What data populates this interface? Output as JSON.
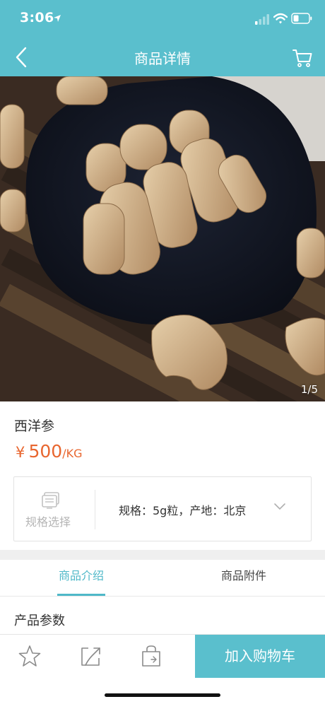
{
  "status_bar": {
    "time": "3:06"
  },
  "nav": {
    "title": "商品详情"
  },
  "gallery": {
    "counter": "1/5"
  },
  "product": {
    "name": "西洋参",
    "price_symbol": "¥",
    "price": "500",
    "unit": "/KG"
  },
  "spec": {
    "select_label": "规格选择",
    "text": "规格：5g粒，产地：北京"
  },
  "tabs": [
    {
      "label": "商品介绍",
      "active": true
    },
    {
      "label": "商品附件",
      "active": false
    }
  ],
  "section": {
    "params_title": "产品参数"
  },
  "bottom_bar": {
    "add_to_cart_label": "加入购物车",
    "icons": [
      "star-icon",
      "share-icon",
      "shop-bag-icon"
    ]
  },
  "colors": {
    "accent": "#5abfcd",
    "tab_active": "#4fb8c8",
    "price": "#e8662f"
  }
}
